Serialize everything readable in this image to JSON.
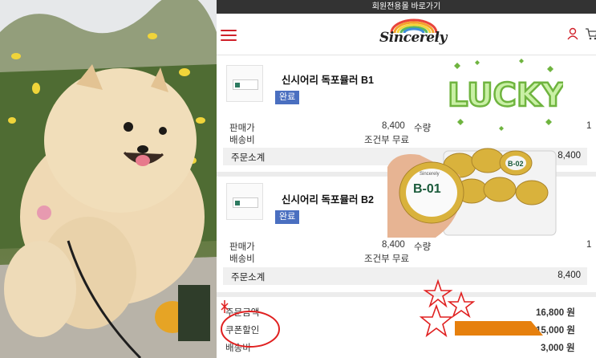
{
  "topbar": {
    "text": "회원전용몰 바로가기"
  },
  "header": {
    "logo_text": "Sincerely",
    "logo_mark": "®"
  },
  "items": [
    {
      "name": "신시어리 독포뮬러 B1",
      "status": "완료",
      "price_label": "판매가",
      "price_value": "8,400",
      "shipping_label": "배송비",
      "shipping_value": "조건부 무료",
      "qty_label": "수량",
      "qty_value": "1",
      "subtotal_label": "주문소계",
      "subtotal_value": "8,400"
    },
    {
      "name": "신시어리 독포뮬러 B2",
      "status": "완료",
      "price_label": "판매가",
      "price_value": "8,400",
      "shipping_label": "배송비",
      "shipping_value": "조건부 무료",
      "qty_label": "수량",
      "qty_value": "1",
      "subtotal_label": "주문소계",
      "subtotal_value": "8,400"
    }
  ],
  "summary": {
    "total_label": "주문금액",
    "total_value": "16,800 원",
    "coupon_label": "쿠폰할인",
    "coupon_value": "15,000 원",
    "shipping_label": "배송비",
    "shipping_value": "3,000 원"
  },
  "stickers": {
    "lucky_text": "LUCKY",
    "product_label": "B-01",
    "product_brand": "Sincerely",
    "product_label_2": "B-02"
  },
  "colors": {
    "accent_red": "#d0212a",
    "badge_blue": "#4a6fc0",
    "lucky_green": "#8fd14f",
    "star_red": "#e02020",
    "bar_orange": "#e6800e",
    "topbar_dark": "#333333"
  }
}
